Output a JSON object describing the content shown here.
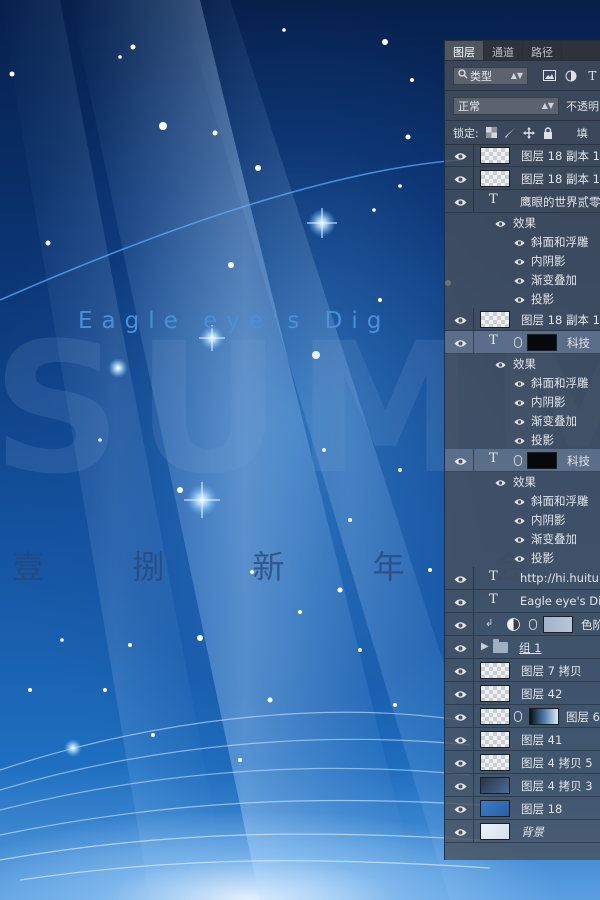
{
  "poster": {
    "subtitle": "Eagle eye's Dig",
    "big_word": "SUMM",
    "cn_line": "壹 捌 新 年 会 议 签 名 墙"
  },
  "layers_panel": {
    "tabs": [
      {
        "label": "图层",
        "active": true
      },
      {
        "label": "通道",
        "active": false
      },
      {
        "label": "路径",
        "active": false
      }
    ],
    "filter_label": "类型",
    "blend_mode": "正常",
    "opacity_label": "不透明",
    "lock_label": "锁定:",
    "fill_label": "填",
    "layers": [
      {
        "kind": "pixel",
        "name": "图层 18 副本 1",
        "thumb": "checker"
      },
      {
        "kind": "pixel",
        "name": "图层 18 副本 1",
        "thumb": "checker"
      },
      {
        "kind": "text",
        "name": "鹰眼的世界贰零"
      },
      {
        "kind": "effects-header",
        "name": "效果"
      },
      {
        "kind": "effect",
        "name": "斜面和浮雕"
      },
      {
        "kind": "effect",
        "name": "内阴影"
      },
      {
        "kind": "effect",
        "name": "渐变叠加"
      },
      {
        "kind": "effect",
        "name": "投影"
      },
      {
        "kind": "pixel",
        "name": "图层 18 副本 1",
        "thumb": "checker"
      },
      {
        "kind": "text-masked",
        "name": "科技",
        "selected": true
      },
      {
        "kind": "effects-header",
        "name": "效果"
      },
      {
        "kind": "effect",
        "name": "斜面和浮雕"
      },
      {
        "kind": "effect",
        "name": "内阴影"
      },
      {
        "kind": "effect",
        "name": "渐变叠加"
      },
      {
        "kind": "effect",
        "name": "投影"
      },
      {
        "kind": "text-masked",
        "name": "科技",
        "selected": true
      },
      {
        "kind": "effects-header",
        "name": "效果"
      },
      {
        "kind": "effect",
        "name": "斜面和浮雕"
      },
      {
        "kind": "effect",
        "name": "内阴影"
      },
      {
        "kind": "effect",
        "name": "渐变叠加"
      },
      {
        "kind": "effect",
        "name": "投影"
      },
      {
        "kind": "text",
        "name": "http://hi.huitu.c"
      },
      {
        "kind": "text",
        "name": "Eagle eye's Dig"
      },
      {
        "kind": "adjustment",
        "name": "色阶"
      },
      {
        "kind": "group",
        "name": "组 1"
      },
      {
        "kind": "pixel",
        "name": "图层 7 拷贝",
        "thumb": "checker"
      },
      {
        "kind": "pixel",
        "name": "图层 42",
        "thumb": "checker"
      },
      {
        "kind": "pixel-masked",
        "name": "图层 6",
        "thumb": "checker"
      },
      {
        "kind": "pixel",
        "name": "图层 41",
        "thumb": "checker"
      },
      {
        "kind": "pixel",
        "name": "图层 4 拷贝 5",
        "thumb": "checker"
      },
      {
        "kind": "pixel",
        "name": "图层 4 拷贝 3",
        "thumb": "dark"
      },
      {
        "kind": "pixel",
        "name": "图层 18",
        "thumb": "blue"
      },
      {
        "kind": "pixel",
        "name": "背景",
        "thumb": "light"
      }
    ]
  }
}
